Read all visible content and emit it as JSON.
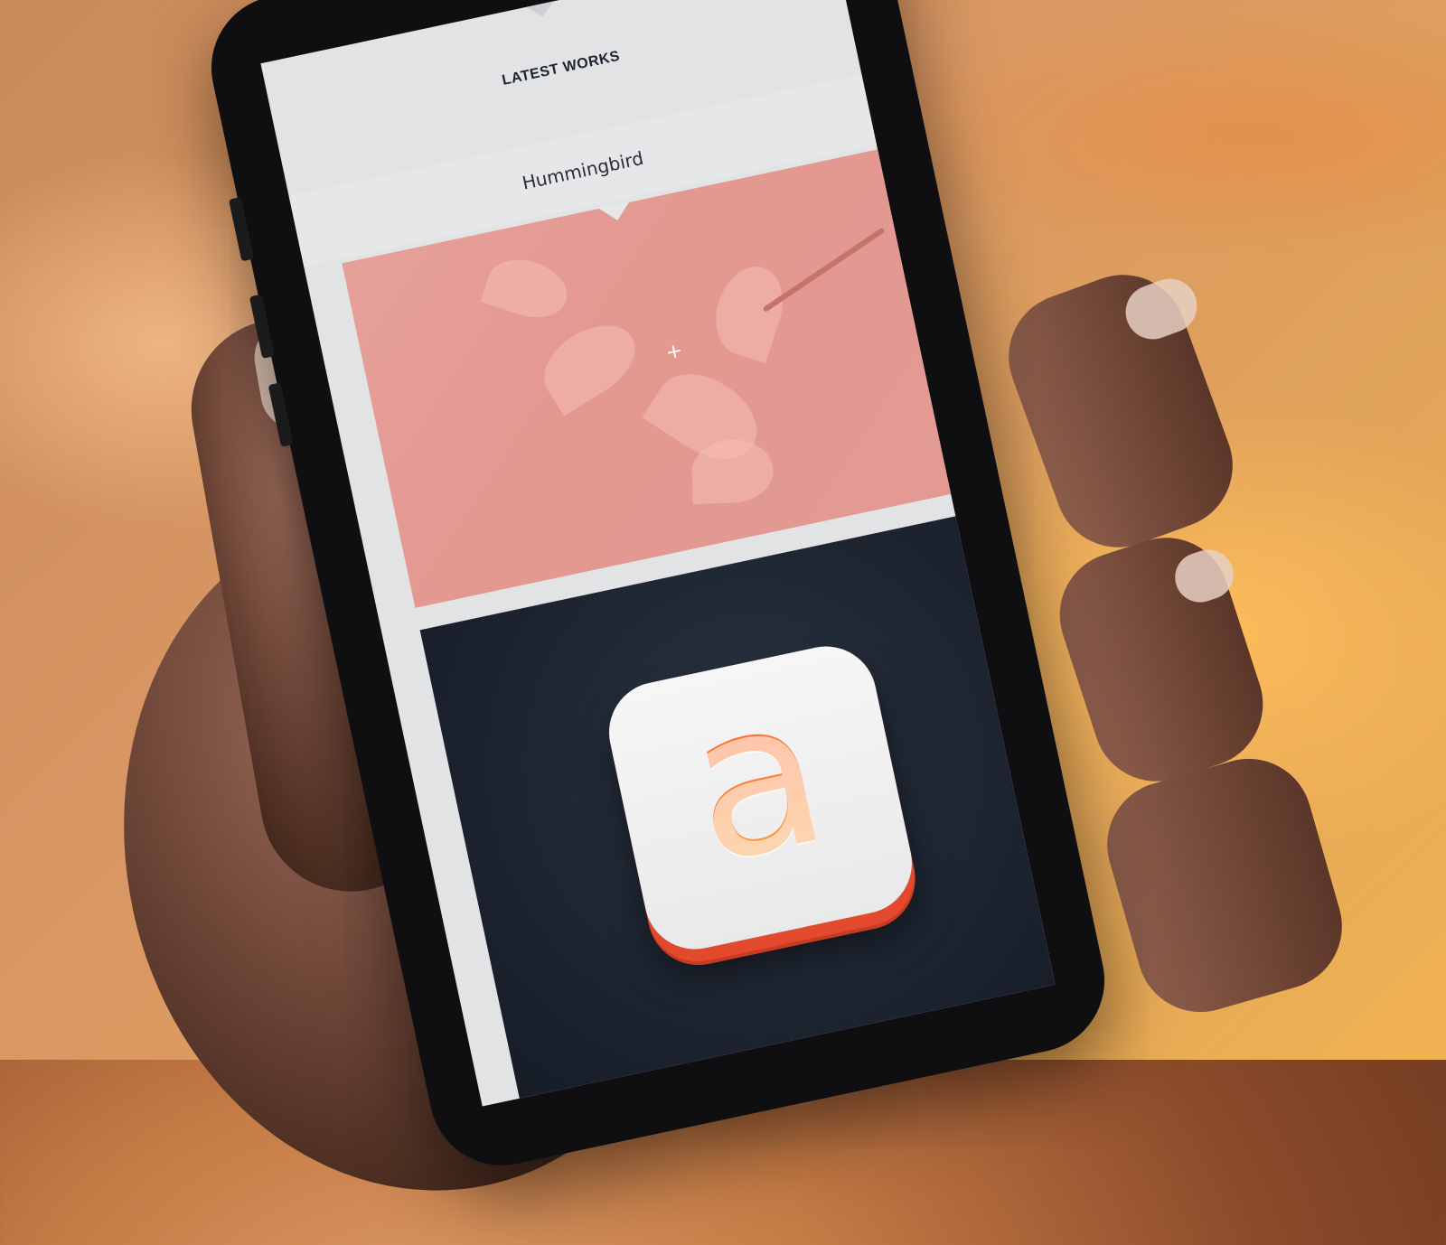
{
  "screen": {
    "section_title": "LATEST WORKS",
    "cards": [
      {
        "title": "Hummingbird",
        "action_glyph": "+"
      },
      {
        "icon_letter": "a"
      }
    ]
  },
  "icons": {
    "expand": "plus-icon",
    "app": "app-letter-a-icon"
  },
  "colors": {
    "pink_card": "#e39890",
    "dark_card": "#1d2430",
    "icon_orange": "#f06a2c",
    "icon_red_base": "#e3492d"
  }
}
